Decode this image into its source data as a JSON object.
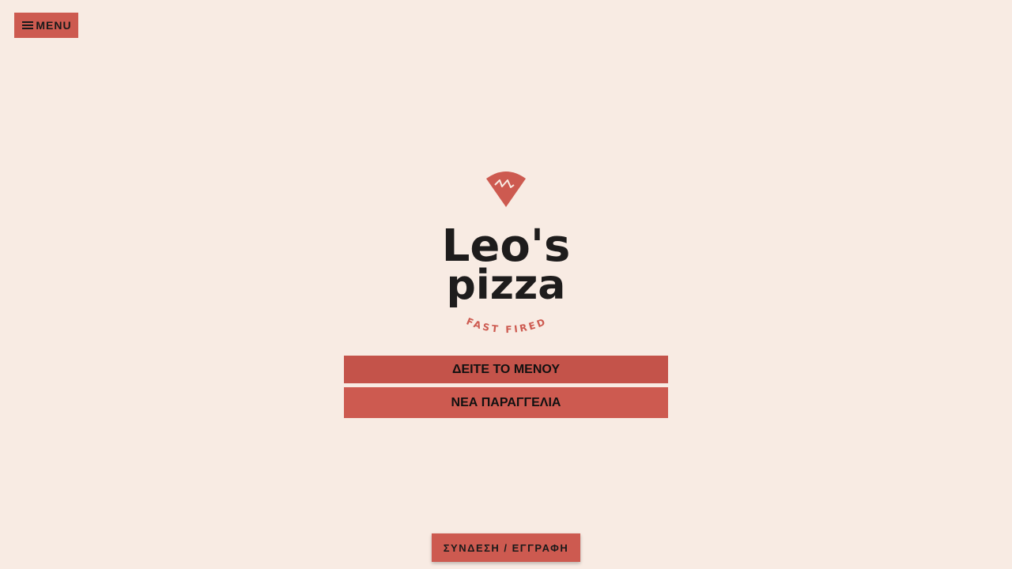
{
  "header": {
    "menu_label": "MENU",
    "menu_icon": "hamburger-icon"
  },
  "logo": {
    "wordmark_line1": "Leo's",
    "wordmark_line2": "pizza",
    "tagline": "FAST FIRED",
    "icon": "pizza-slice-icon"
  },
  "actions": {
    "view_menu_label": "ΔΕΙΤΕ ΤΟ ΜΕΝΟΥ",
    "new_order_label": "ΝΕΑ ΠΑΡΑΓΓΕΛΙΑ"
  },
  "footer": {
    "login_label": "ΣΥΝΔΕΣΗ / ΕΓΓΡΑΦΗ"
  },
  "colors": {
    "background": "#f8ebe3",
    "accent": "#cd5a50",
    "accent_dark": "#c4534a",
    "text": "#1a1a1a"
  }
}
